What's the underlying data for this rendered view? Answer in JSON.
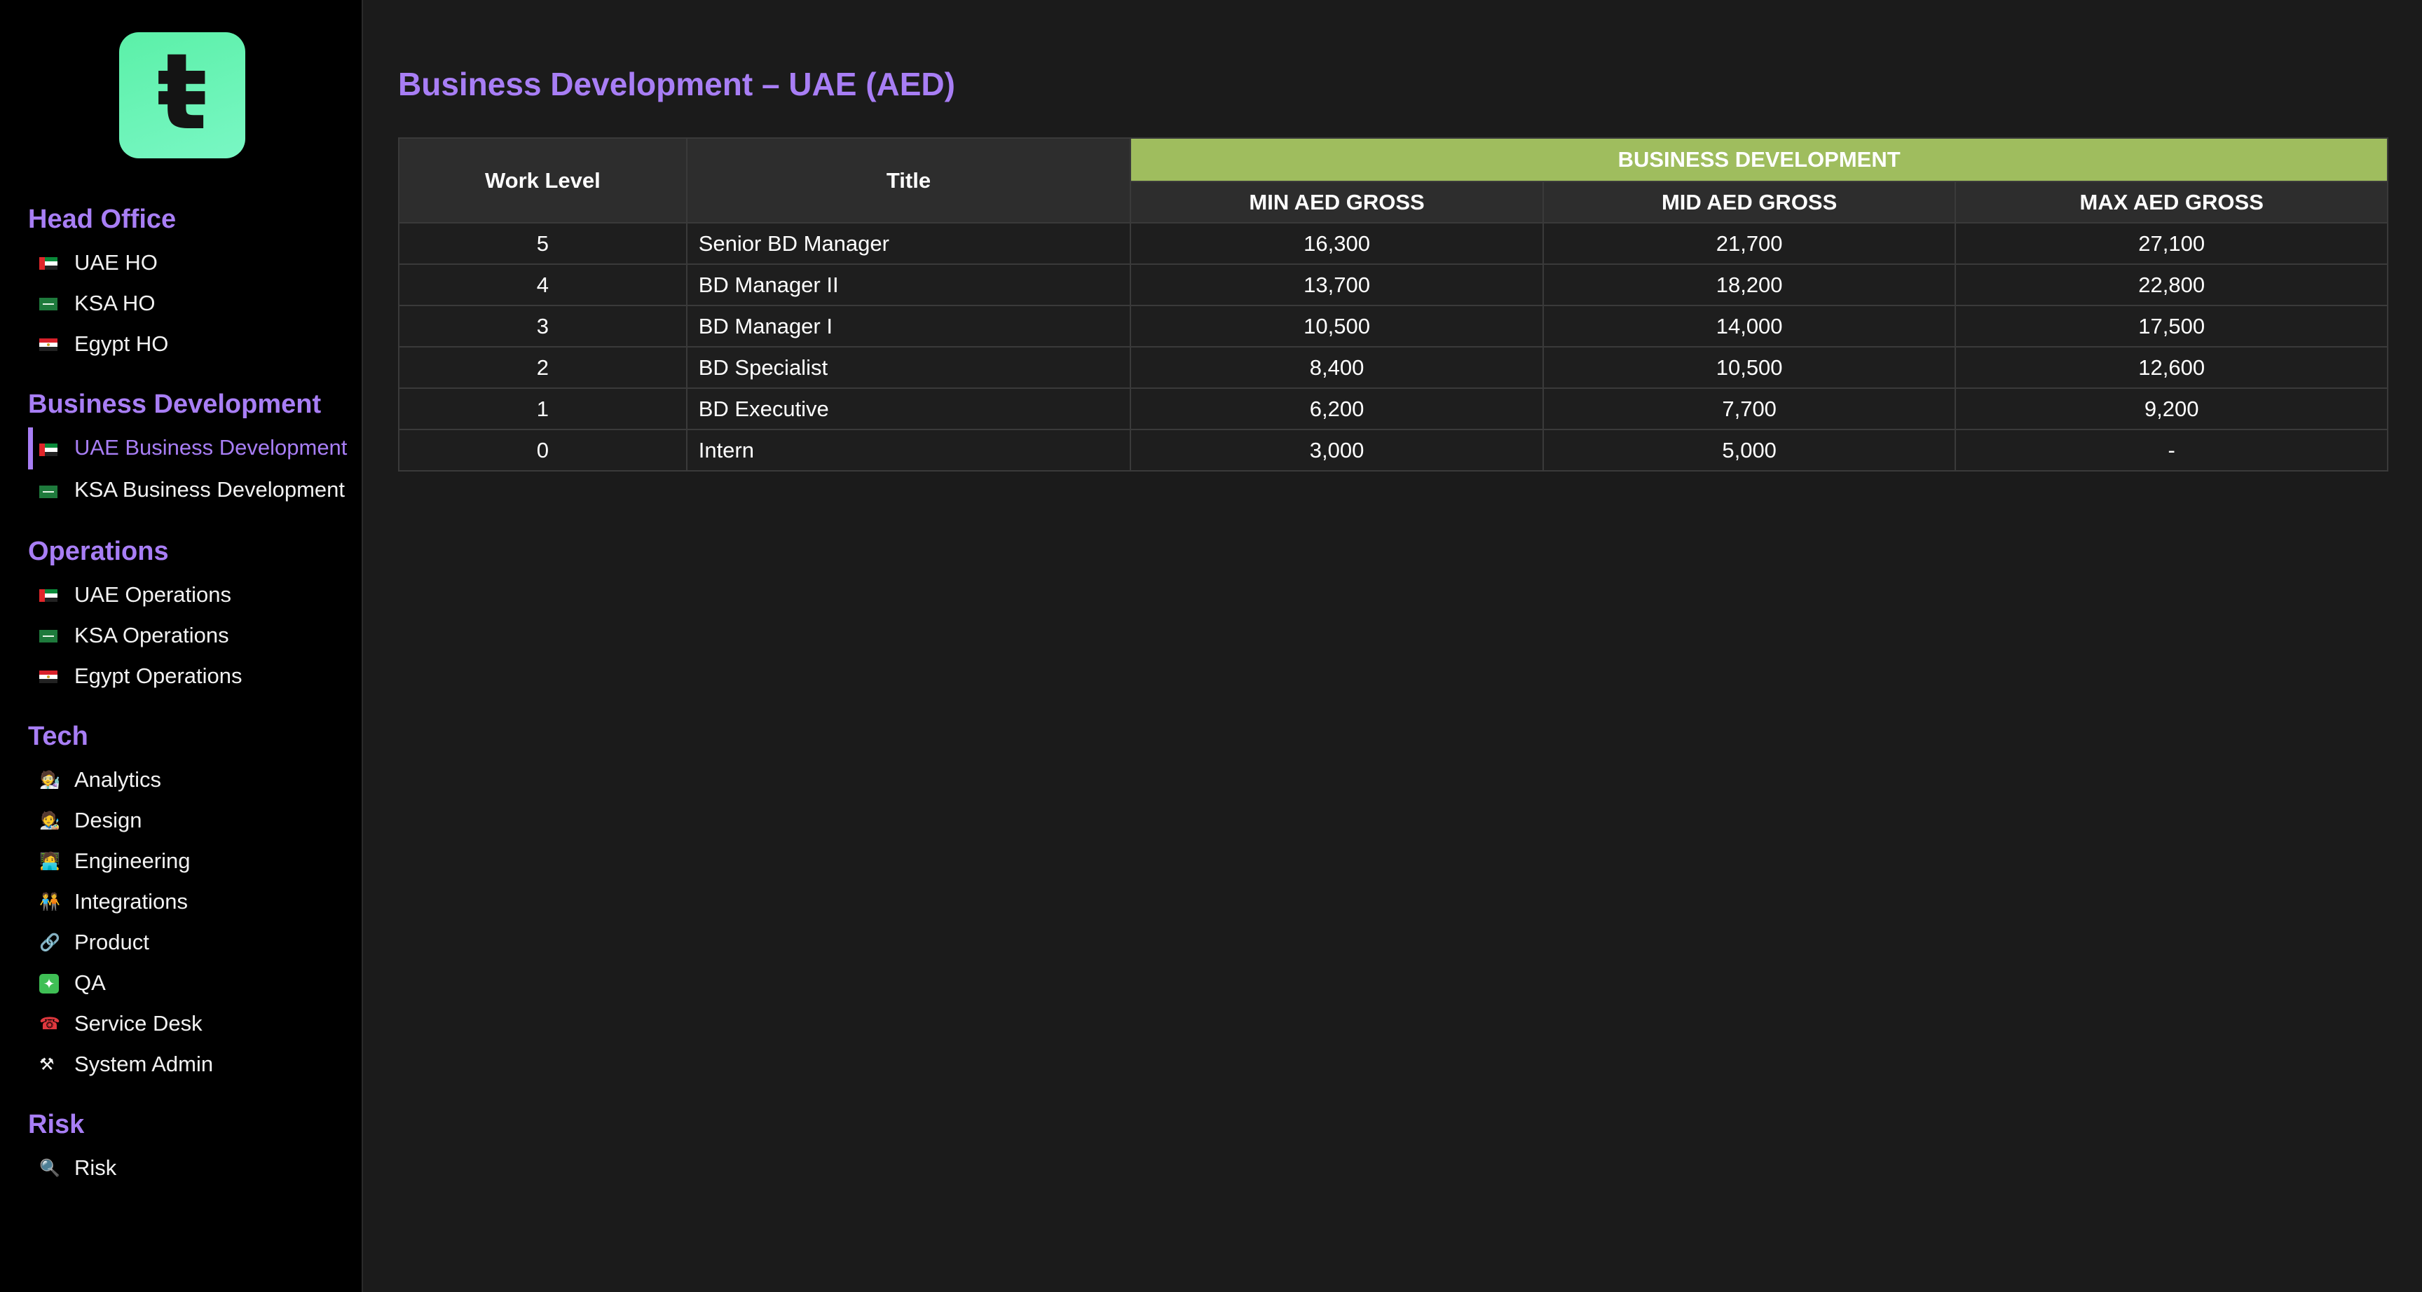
{
  "brand": {
    "logo_glyph": "ŧ",
    "accent": "#a87ef5",
    "logo_color": "#5bf0a8"
  },
  "sidebar": {
    "sections": [
      {
        "title": "Head Office",
        "items": [
          {
            "label": "UAE HO",
            "icon": "uae-flag"
          },
          {
            "label": "KSA HO",
            "icon": "ksa-flag"
          },
          {
            "label": "Egypt HO",
            "icon": "egypt-flag"
          }
        ]
      },
      {
        "title": "Business Development",
        "items": [
          {
            "label": "UAE Business Development",
            "icon": "uae-flag",
            "active": true
          },
          {
            "label": "KSA Business Development",
            "icon": "ksa-flag"
          }
        ]
      },
      {
        "title": "Operations",
        "items": [
          {
            "label": "UAE Operations",
            "icon": "uae-flag"
          },
          {
            "label": "KSA Operations",
            "icon": "ksa-flag"
          },
          {
            "label": "Egypt Operations",
            "icon": "egypt-flag"
          }
        ]
      },
      {
        "title": "Tech",
        "items": [
          {
            "label": "Analytics",
            "icon": "scientist-icon",
            "glyph": "🧑‍🔬"
          },
          {
            "label": "Design",
            "icon": "artist-icon",
            "glyph": "🧑‍🎨"
          },
          {
            "label": "Engineering",
            "icon": "technologist-icon",
            "glyph": "🧑‍💻"
          },
          {
            "label": "Integrations",
            "icon": "people-holding-hands-icon",
            "glyph": "🧑‍🤝‍🧑"
          },
          {
            "label": "Product",
            "icon": "link-icon",
            "glyph": "🔗"
          },
          {
            "label": "QA",
            "icon": "sparkle-icon",
            "glyph": "✦"
          },
          {
            "label": "Service Desk",
            "icon": "telephone-icon",
            "glyph": "☎"
          },
          {
            "label": "System Admin",
            "icon": "compass-tool-icon",
            "glyph": "⚒"
          }
        ]
      },
      {
        "title": "Risk",
        "items": [
          {
            "label": "Risk",
            "icon": "magnifier-icon",
            "glyph": "🔍"
          }
        ]
      }
    ]
  },
  "main": {
    "title": "Business Development – UAE (AED)",
    "table": {
      "headers": {
        "work_level": "Work Level",
        "title": "Title",
        "group": "BUSINESS DEVELOPMENT",
        "min": "MIN AED GROSS",
        "mid": "MID AED GROSS",
        "max": "MAX AED GROSS"
      },
      "group_color": "#9fbd5e",
      "rows": [
        {
          "level": "5",
          "title": "Senior BD Manager",
          "min": "16,300",
          "mid": "21,700",
          "max": "27,100"
        },
        {
          "level": "4",
          "title": "BD Manager II",
          "min": "13,700",
          "mid": "18,200",
          "max": "22,800"
        },
        {
          "level": "3",
          "title": "BD Manager I",
          "min": "10,500",
          "mid": "14,000",
          "max": "17,500"
        },
        {
          "level": "2",
          "title": "BD Specialist",
          "min": "8,400",
          "mid": "10,500",
          "max": "12,600"
        },
        {
          "level": "1",
          "title": "BD Executive",
          "min": "6,200",
          "mid": "7,700",
          "max": "9,200"
        },
        {
          "level": "0",
          "title": "Intern",
          "min": "3,000",
          "mid": "5,000",
          "max": "-"
        }
      ]
    }
  }
}
